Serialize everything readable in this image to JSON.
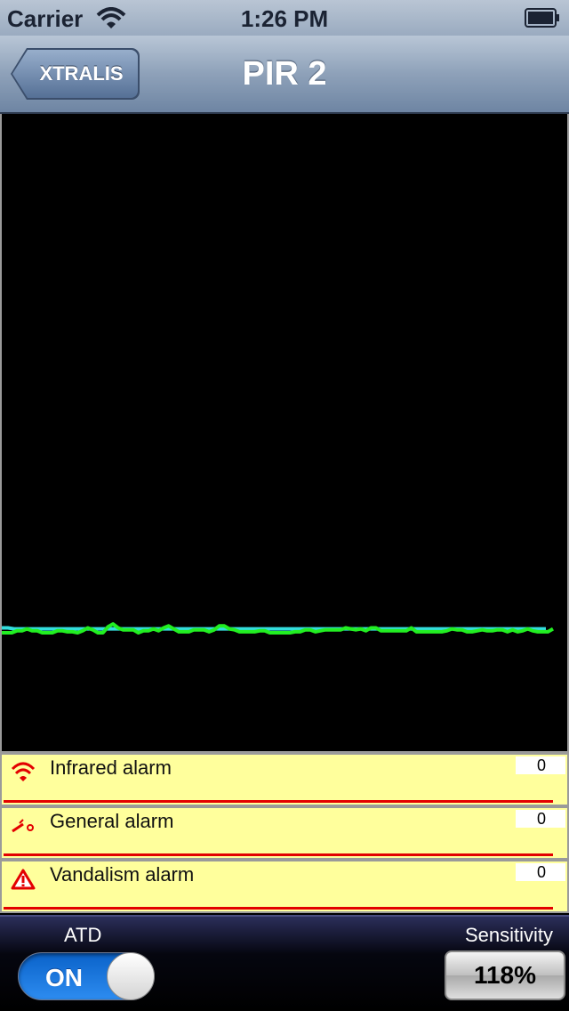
{
  "status_bar": {
    "carrier": "Carrier",
    "time": "1:26 PM",
    "wifi_icon": "wifi-icon",
    "battery_icon": "battery-icon"
  },
  "nav": {
    "back_label": "XTRALIS",
    "title": "PIR 2"
  },
  "chart_data": {
    "type": "line",
    "series": [
      {
        "color": "#33dddd",
        "values": [
          75,
          75,
          74,
          74,
          74,
          74,
          74,
          74,
          74,
          74,
          74,
          74,
          74,
          74,
          74,
          74,
          74,
          74,
          74,
          74,
          74,
          74,
          74,
          74,
          74,
          74,
          74,
          74,
          74,
          74,
          74,
          74,
          74,
          74,
          74,
          74,
          74,
          74,
          74,
          74,
          74,
          74,
          74,
          74,
          74,
          74,
          74,
          74,
          74,
          74,
          74,
          74,
          74,
          74,
          74,
          74,
          74,
          74,
          74,
          74,
          74,
          74,
          74,
          74,
          74,
          74,
          74,
          74,
          74,
          74,
          74,
          74,
          74,
          74,
          74,
          74,
          74,
          74,
          74,
          74,
          74,
          74,
          74,
          74,
          74,
          74,
          74,
          74,
          74,
          74
        ]
      },
      {
        "color": "#22ee22",
        "values": [
          70,
          70,
          70,
          72,
          72,
          74,
          72,
          72,
          70,
          70,
          70,
          72,
          72,
          71,
          71,
          70,
          72,
          75,
          73,
          70,
          70,
          76,
          79,
          75,
          73,
          73,
          73,
          70,
          72,
          72,
          74,
          72,
          75,
          77,
          74,
          71,
          71,
          71,
          73,
          73,
          73,
          71,
          73,
          77,
          77,
          74,
          73,
          71,
          71,
          71,
          71,
          72,
          72,
          70,
          70,
          70,
          70,
          70,
          71,
          71,
          73,
          73,
          71,
          72,
          73,
          73,
          73,
          73,
          75,
          74,
          73,
          74,
          72,
          75,
          75,
          72,
          72,
          72,
          72,
          72,
          72,
          75,
          71,
          71,
          71,
          71,
          71,
          71,
          72,
          74,
          73,
          73,
          71,
          71,
          72,
          73,
          72,
          72,
          73,
          73,
          71,
          73,
          71,
          72,
          74,
          72,
          71,
          71,
          71,
          74
        ]
      }
    ]
  },
  "alarms": [
    {
      "label": "Infrared alarm",
      "count": "0",
      "icon": "wifi-alarm-icon",
      "color": "#e30000"
    },
    {
      "label": "General alarm",
      "count": "0",
      "icon": "key-alarm-icon",
      "color": "#e30000"
    },
    {
      "label": "Vandalism alarm",
      "count": "0",
      "icon": "warning-triangle-icon",
      "color": "#e30000"
    }
  ],
  "controls": {
    "atd_label": "ATD",
    "atd_toggle": "ON",
    "sensitivity_label": "Sensitivity",
    "sensitivity_value": "118%"
  }
}
